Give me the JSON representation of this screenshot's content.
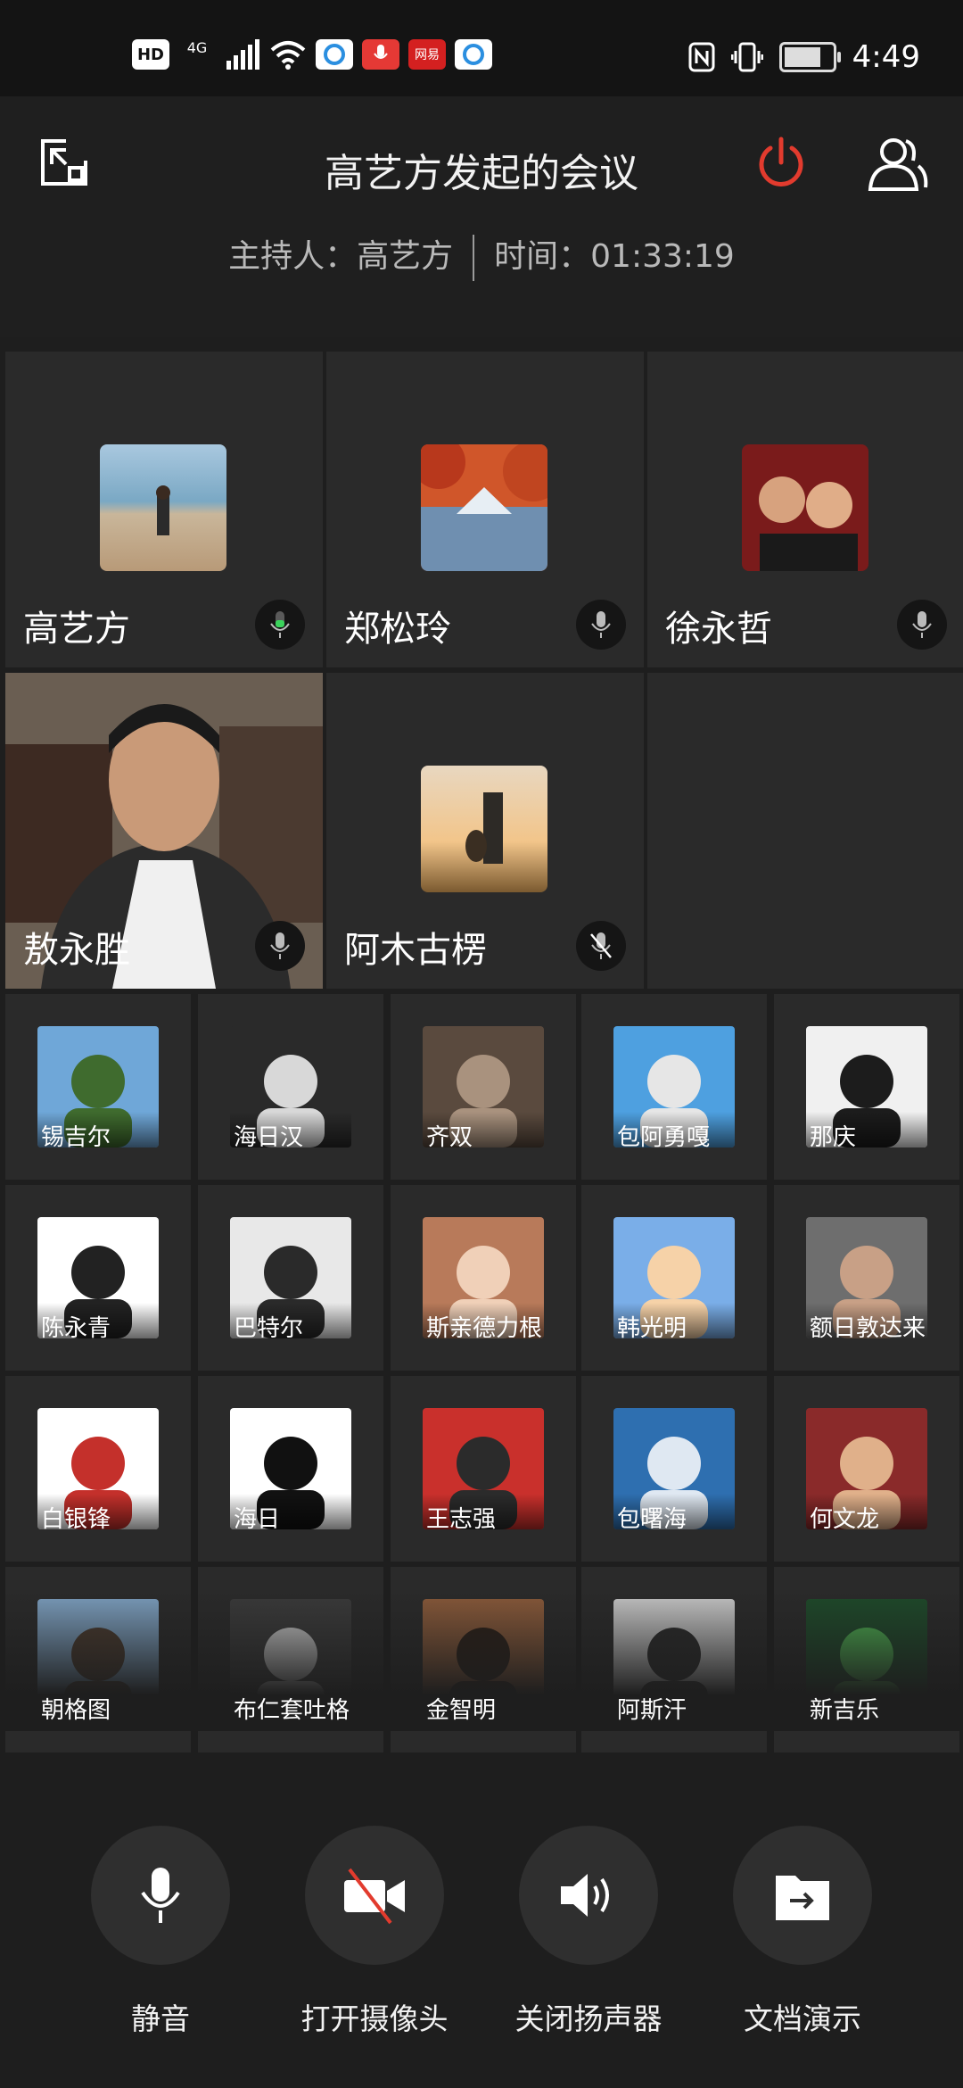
{
  "status_bar": {
    "left_icons": [
      "HD",
      "4G",
      "signal-icon",
      "wifi-icon",
      "app-icon-blue",
      "mic-app-icon",
      "网易",
      "app-icon-blue-2"
    ],
    "hd": "HD",
    "net": "4G",
    "netease": "网易",
    "time": "4:49",
    "right_icons": [
      "nfc-icon",
      "vibrate-icon",
      "battery-icon"
    ]
  },
  "header": {
    "title": "高艺方发起的会议",
    "host_label": "主持人：高艺方",
    "time_label": "时间：01:33:19",
    "accent_red": "#e23b2e"
  },
  "participants_large": [
    {
      "name": "高艺方",
      "mic": "active"
    },
    {
      "name": "郑松玲",
      "mic": "on"
    },
    {
      "name": "徐永哲",
      "mic": "on"
    },
    {
      "name": "敖永胜",
      "mic": "on",
      "video": true
    },
    {
      "name": "阿木古楞",
      "mic": "muted"
    }
  ],
  "participants_grid": [
    {
      "name": "锡吉尔"
    },
    {
      "name": "海日汉"
    },
    {
      "name": "齐双"
    },
    {
      "name": "包阿勇嘎"
    },
    {
      "name": "那庆"
    },
    {
      "name": "陈永青"
    },
    {
      "name": "巴特尔"
    },
    {
      "name": "斯亲德力根"
    },
    {
      "name": "韩光明"
    },
    {
      "name": "额日敦达来"
    },
    {
      "name": "白银锋"
    },
    {
      "name": "海日"
    },
    {
      "name": "王志强"
    },
    {
      "name": "包曙海"
    },
    {
      "name": "何文龙"
    },
    {
      "name": "朝格图"
    },
    {
      "name": "布仁套吐格"
    },
    {
      "name": "金智明"
    },
    {
      "name": "阿斯汗"
    },
    {
      "name": "新吉乐"
    }
  ],
  "controls": [
    {
      "label": "静音",
      "icon": "microphone-icon"
    },
    {
      "label": "打开摄像头",
      "icon": "camera-off-icon"
    },
    {
      "label": "关闭扬声器",
      "icon": "speaker-icon"
    },
    {
      "label": "文档演示",
      "icon": "document-share-icon"
    }
  ]
}
